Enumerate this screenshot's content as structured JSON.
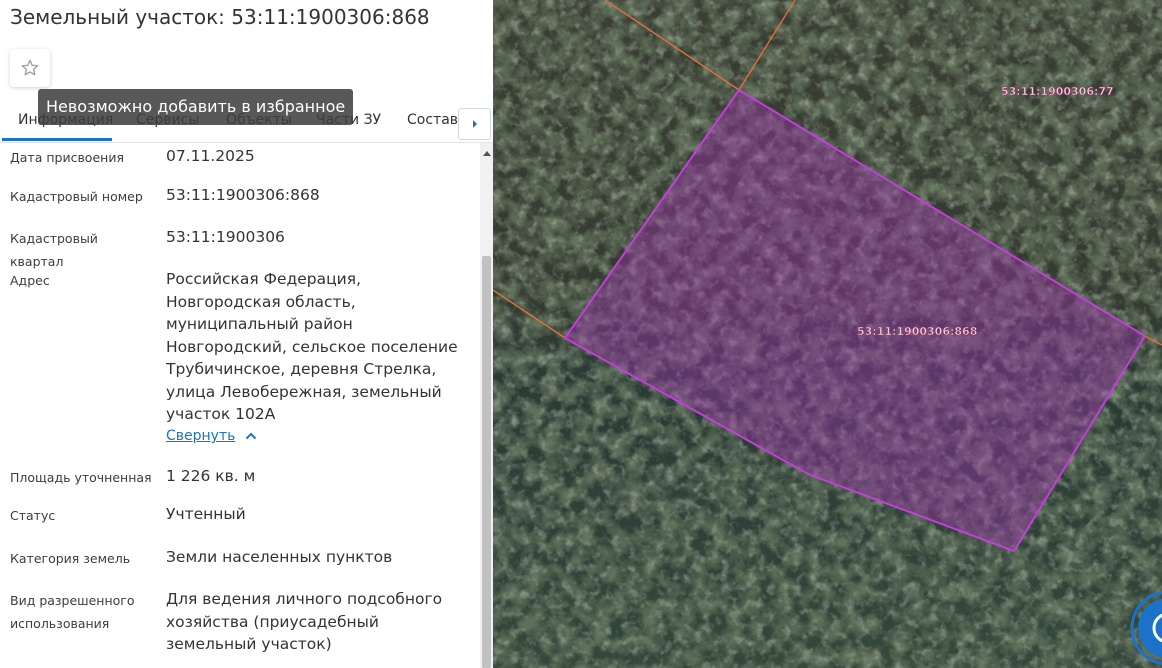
{
  "panel": {
    "title": "Земельный участок: 53:11:1900306:868",
    "favorite_tooltip": "Невозможно добавить в избранное",
    "tabs": [
      {
        "label": "Информация"
      },
      {
        "label": "Сервисы"
      },
      {
        "label": "Объекты"
      },
      {
        "label": "Части ЗУ"
      },
      {
        "label": "Состав"
      }
    ],
    "fields": {
      "date": {
        "label": "Дата присвоения",
        "value": "07.11.2025"
      },
      "cad_number": {
        "label": "Кадастровый номер",
        "value": "53:11:1900306:868"
      },
      "cad_block": {
        "label": "Кадастровый квартал",
        "value": "53:11:1900306"
      },
      "address": {
        "label": "Адрес",
        "value": "Российская Федерация, Новгородская область, муниципальный район Новгородский, сельское поселение Трубичинское, деревня Стрелка, улица Левобережная, земельный участок 102А"
      },
      "area": {
        "label": "Площадь уточненная",
        "value": "1 226 кв. м"
      },
      "status": {
        "label": "Статус",
        "value": "Учтенный"
      },
      "category": {
        "label": "Категория земель",
        "value": "Земли населенных пунктов"
      },
      "usage": {
        "label": "Вид разрешенного использования",
        "value": "Для ведения личного подсобного хозяйства (приусадебный земельный участок)"
      }
    },
    "collapse_link": "Свернуть"
  },
  "map": {
    "selected_parcel_label": "53:11:1900306:868",
    "neighbor_parcel_label": "53:11:1900306:77",
    "parcel_fill": "#a030b0",
    "parcel_stroke": "#c040d8",
    "boundary_color": "#e0703a"
  },
  "icons": {
    "favorite": "star-icon",
    "tab_next": "caret-right-icon",
    "scroll_up": "caret-up-icon",
    "collapse": "chevron-up-icon"
  }
}
